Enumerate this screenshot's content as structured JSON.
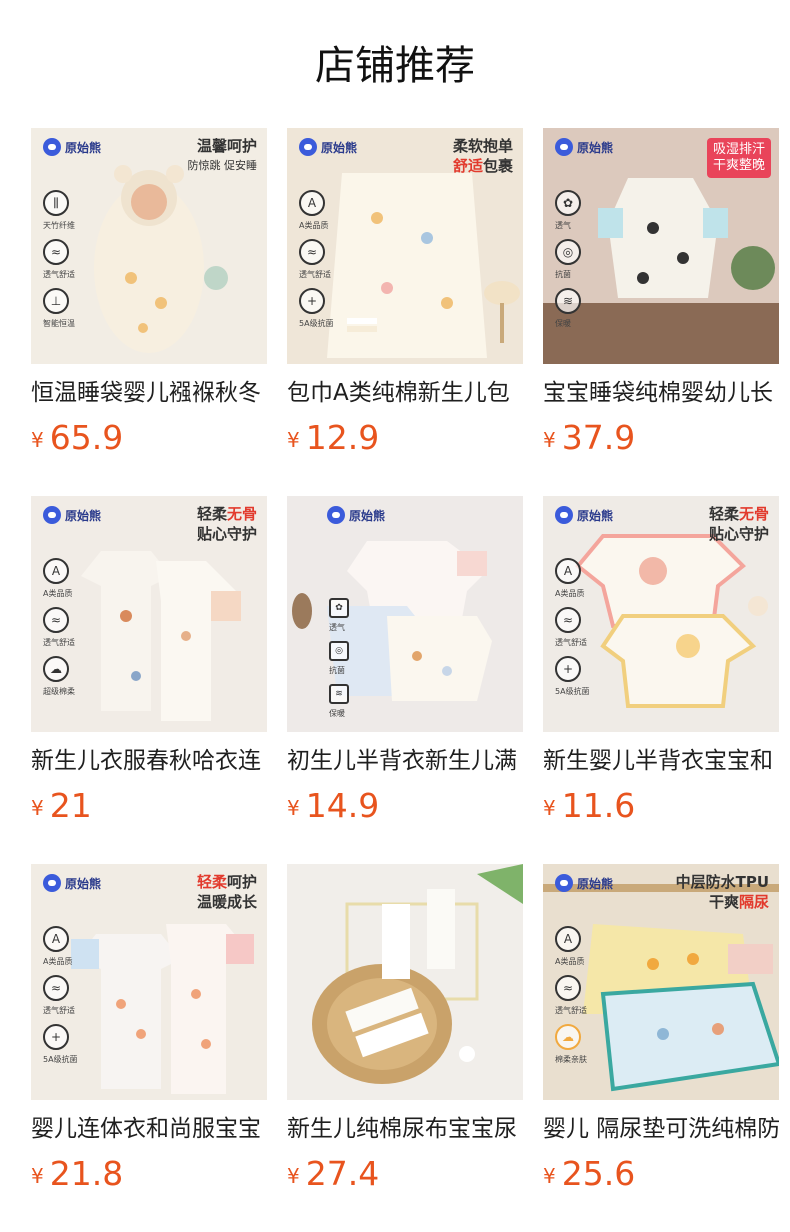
{
  "header": {
    "title": "店铺推荐"
  },
  "brand_text": "原始熊",
  "products": [
    {
      "title": "恒温睡袋婴儿襁褓秋冬",
      "currency": "¥",
      "price": "65.9",
      "image": {
        "bg": "#f2ede4",
        "slogan1": "温馨呵护",
        "slogan2": "防惊跳 促安睡",
        "icons": [
          "天竹纤维",
          "透气舒适",
          "智能恒温"
        ]
      }
    },
    {
      "title": "包巾A类纯棉新生儿包",
      "currency": "¥",
      "price": "12.9",
      "image": {
        "bg": "#efe6d8",
        "slogan1": "柔软抱单",
        "slogan2_red": "舒适",
        "slogan2": "包裹",
        "icons": [
          "A类品质",
          "透气舒适",
          "5A级抗菌"
        ]
      }
    },
    {
      "title": "宝宝睡袋纯棉婴幼儿长",
      "currency": "¥",
      "price": "37.9",
      "image": {
        "bg": "#dcc9bd",
        "badge1": "吸湿排汗",
        "badge2": "干爽整晚",
        "icons": [
          "透气",
          "抗菌",
          "保暖"
        ]
      }
    },
    {
      "title": "新生儿衣服春秋哈衣连",
      "currency": "¥",
      "price": "21",
      "image": {
        "bg": "#f1ece6",
        "slogan1": "轻柔",
        "slogan1_red": "无骨",
        "slogan2": "贴心守护",
        "icons": [
          "A类品质",
          "透气舒适",
          "超级棉柔"
        ]
      }
    },
    {
      "title": "初生儿半背衣新生儿满",
      "currency": "¥",
      "price": "14.9",
      "image": {
        "bg": "#eeeae8",
        "icons": [
          "透气",
          "抗菌",
          "保暖"
        ]
      }
    },
    {
      "title": "新生婴儿半背衣宝宝和",
      "currency": "¥",
      "price": "11.6",
      "image": {
        "bg": "#efebe6",
        "slogan1": "轻柔",
        "slogan1_red": "无骨",
        "slogan2": "贴心守护",
        "icons": [
          "A类品质",
          "透气舒适",
          "5A级抗菌"
        ]
      }
    },
    {
      "title": "婴儿连体衣和尚服宝宝",
      "currency": "¥",
      "price": "21.8",
      "image": {
        "bg": "#f1ece4",
        "slogan1_red": "轻柔",
        "slogan1": "呵护",
        "slogan2": "温暖成长",
        "icons": [
          "A类品质",
          "透气舒适",
          "5A级抗菌"
        ]
      }
    },
    {
      "title": "新生儿纯棉尿布宝宝尿",
      "currency": "¥",
      "price": "27.4",
      "image": {
        "bg": "#f1eeea"
      }
    },
    {
      "title": "婴儿 隔尿垫可洗纯棉防",
      "currency": "¥",
      "price": "25.6",
      "image": {
        "bg": "#e9dfcf",
        "slogan1": "中层防水TPU",
        "slogan2": "干爽",
        "slogan2_red": "隔尿",
        "icons": [
          "A类品质",
          "透气舒适",
          "棉柔亲肤"
        ]
      }
    }
  ]
}
